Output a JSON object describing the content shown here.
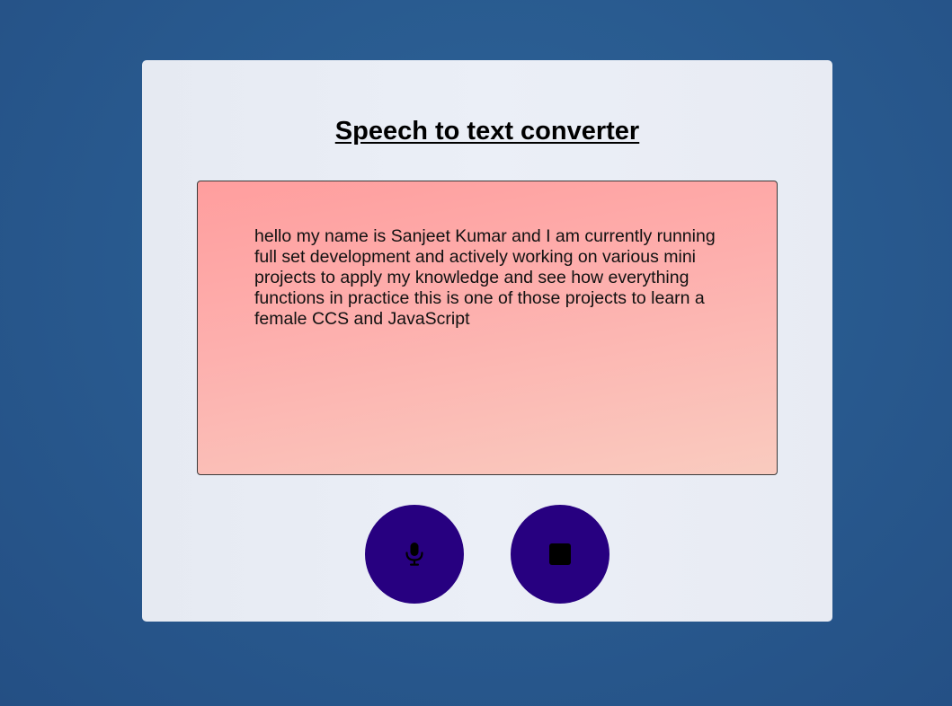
{
  "app": {
    "title": "Speech to text converter"
  },
  "transcript": {
    "text": "hello my name is Sanjeet Kumar and I am currently running full set development and actively working on various mini projects to apply my knowledge and see how everything functions in practice this is one of those projects to learn a female CCS and JavaScript"
  },
  "controls": {
    "start": {
      "icon": "microphone-icon"
    },
    "stop": {
      "icon": "stop-icon"
    }
  },
  "colors": {
    "background": "#295b90",
    "card": "#ebeff7",
    "transcript_top": "#ff9e9e",
    "transcript_bottom": "#f9cbbf",
    "button": "#270080",
    "icon": "#000000"
  }
}
